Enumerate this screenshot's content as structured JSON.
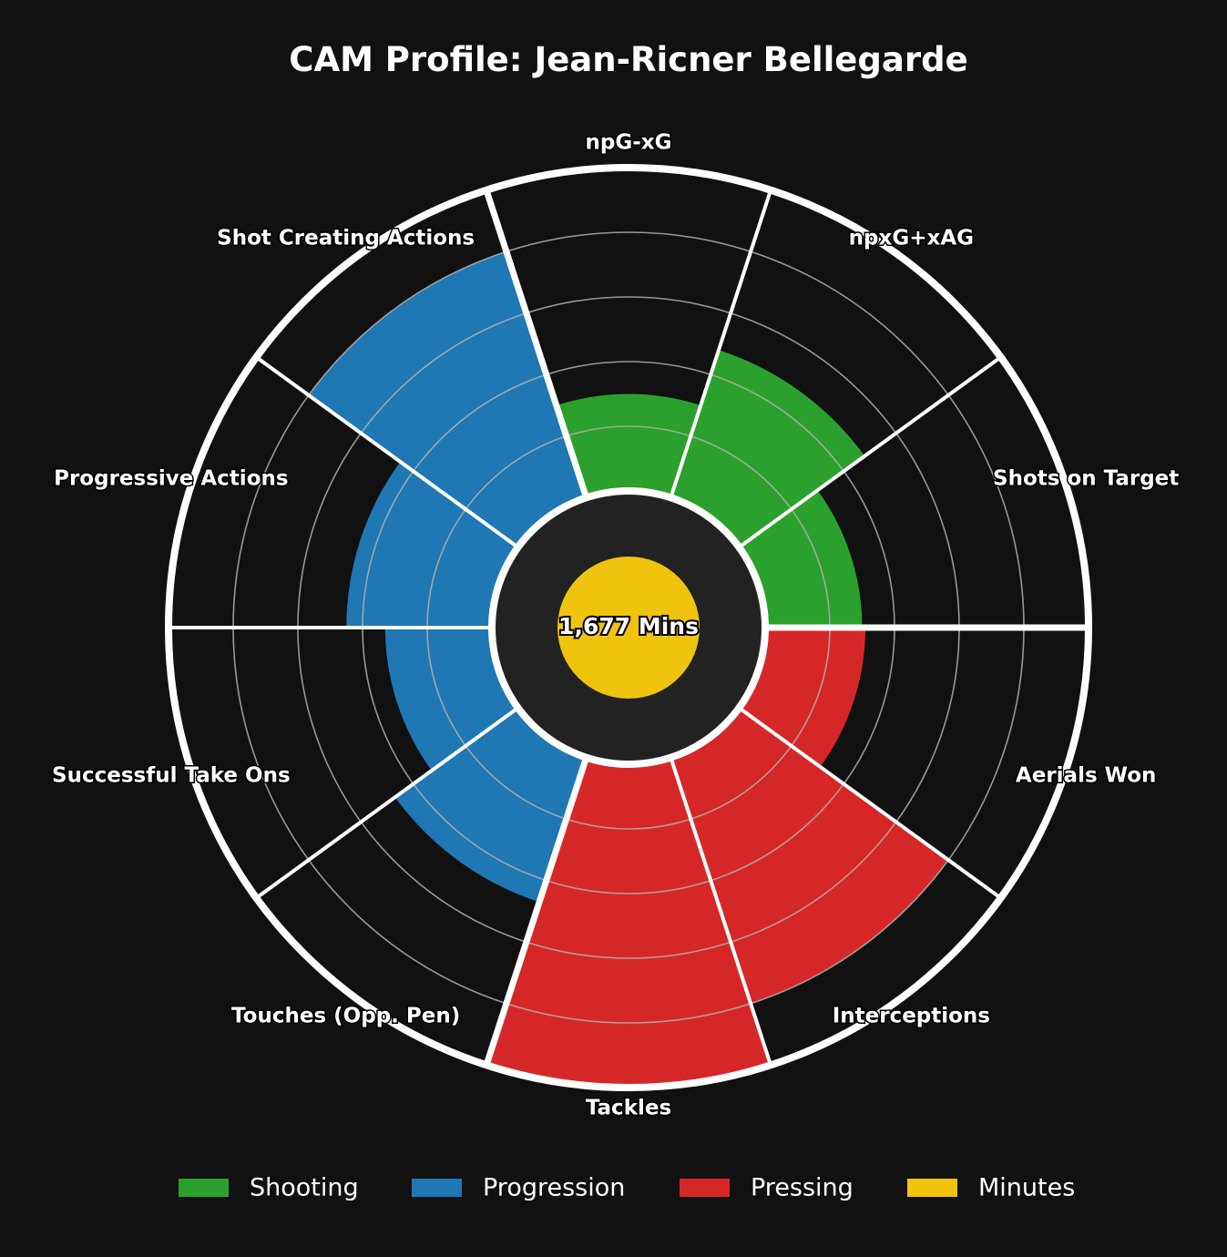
{
  "chart_data": {
    "type": "polar-bar",
    "title": "CAM Profile: Jean-Ricner Bellegarde",
    "center_label": "1,677 Mins",
    "rlim": [
      0,
      100
    ],
    "grid": true,
    "legend_placement": "bottom-center",
    "categories": [
      "npG-xG",
      "npxG+xAG",
      "Shots on Target",
      "Aerials Won",
      "Interceptions",
      "Tackles",
      "Touches (Opp. Pen)",
      "Successful Take Ons",
      "Progressive Actions",
      "Shot Creating Actions"
    ],
    "values": [
      30,
      48,
      30,
      31,
      80,
      99,
      47,
      33,
      45,
      80
    ],
    "groups": [
      "Shooting",
      "Shooting",
      "Shooting",
      "Pressing",
      "Pressing",
      "Pressing",
      "Progression",
      "Progression",
      "Progression",
      "Progression"
    ],
    "minutes_value": 1677,
    "legend": [
      {
        "label": "Shooting",
        "color": "#2ca02c"
      },
      {
        "label": "Progression",
        "color": "#1f77b4"
      },
      {
        "label": "Pressing",
        "color": "#d62728"
      },
      {
        "label": "Minutes",
        "color": "#f0c30f"
      }
    ],
    "colors": {
      "Shooting": "#2ca02c",
      "Progression": "#1f77b4",
      "Pressing": "#d62728",
      "Minutes": "#f0c30f",
      "background": "#111111",
      "hub": "#222222",
      "outline": "#ffffff"
    }
  }
}
